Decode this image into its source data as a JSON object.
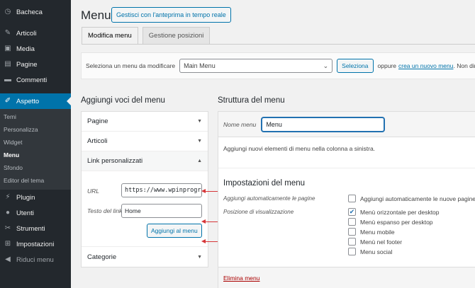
{
  "sidebar": {
    "top_items": [
      {
        "label": "Bacheca",
        "icon": "dashboard-icon",
        "glyph": "◷"
      },
      {
        "label": "Articoli",
        "icon": "pin-icon",
        "glyph": "✎"
      },
      {
        "label": "Media",
        "icon": "media-icon",
        "glyph": "▣"
      },
      {
        "label": "Pagine",
        "icon": "pages-icon",
        "glyph": "▤"
      },
      {
        "label": "Commenti",
        "icon": "comments-icon",
        "glyph": "▬"
      }
    ],
    "active_item": {
      "label": "Aspetto",
      "icon": "appearance-icon",
      "glyph": "✐"
    },
    "submenu": [
      "Temi",
      "Personalizza",
      "Widget",
      "Menu",
      "Sfondo",
      "Editor del tema"
    ],
    "current_submenu": "Menu",
    "bottom_items": [
      {
        "label": "Plugin",
        "icon": "plugin-icon",
        "glyph": "⚡"
      },
      {
        "label": "Utenti",
        "icon": "users-icon",
        "glyph": "●"
      },
      {
        "label": "Strumenti",
        "icon": "tools-icon",
        "glyph": "✂"
      },
      {
        "label": "Impostazioni",
        "icon": "settings-icon",
        "glyph": "⊞"
      }
    ],
    "collapse_label": "Riduci menu",
    "collapse_glyph": "◀"
  },
  "header": {
    "title": "Menu",
    "preview_button": "Gestisci con l'anteprima in tempo reale"
  },
  "tabs": [
    {
      "label": "Modifica menu",
      "active": true
    },
    {
      "label": "Gestione posizioni",
      "active": false
    }
  ],
  "select_bar": {
    "label": "Seleziona un menu da modificare",
    "selected": "Main Menu",
    "button": "Seleziona",
    "or_text": "oppure",
    "create_link": "crea un nuovo menu",
    "trailing_text": ". Non dime"
  },
  "left_panel": {
    "title": "Aggiungi voci del menu",
    "sections": [
      {
        "label": "Pagine",
        "arrow": "▼"
      },
      {
        "label": "Articoli",
        "arrow": "▼"
      },
      {
        "label": "Link personalizzati",
        "arrow": "▲"
      }
    ],
    "url_label": "URL",
    "url_value": "https://www.wpinprogr",
    "link_text_label": "Testo del link",
    "link_text_value": "Home",
    "add_button": "Aggiungi al menu",
    "last_section": {
      "label": "Categorie",
      "arrow": "▼"
    }
  },
  "right_panel": {
    "title": "Struttura del menu",
    "name_label": "Nome menu",
    "name_value": "Menu",
    "hint": "Aggiungi nuovi elementi di menu nella colonna a sinistra.",
    "settings_title": "Impostazioni del menu",
    "auto_add_label": "Aggiungi automaticamente le pagine",
    "auto_add_option": "Aggiungi automaticamente le nuove pagine",
    "display_label": "Posizione di visualizzazione",
    "locations": [
      {
        "label": "Menù orizzontale per desktop",
        "checked": true
      },
      {
        "label": "Menù espanso per desktop",
        "checked": false
      },
      {
        "label": "Menu mobile",
        "checked": false
      },
      {
        "label": "Menù nel footer",
        "checked": false
      },
      {
        "label": "Menu social",
        "checked": false
      }
    ],
    "delete_link": "Elimina menu"
  },
  "colors": {
    "accent": "#0073aa",
    "sidebar": "#23282d",
    "annotation_arrow": "#d63638"
  }
}
